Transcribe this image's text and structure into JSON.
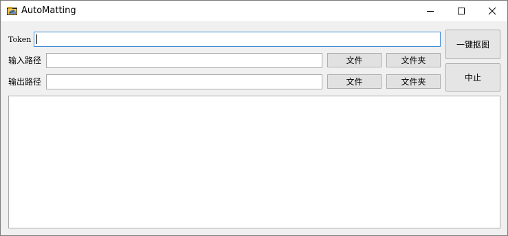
{
  "window": {
    "title": "AutoMatting",
    "icon": "folder-app-icon",
    "controls": {
      "minimize_icon": "minimize-icon",
      "maximize_icon": "maximize-icon",
      "close_icon": "close-icon"
    }
  },
  "form": {
    "token": {
      "label": "Token",
      "value": "",
      "placeholder": ""
    },
    "input_path": {
      "label": "输入路径",
      "value": "",
      "file_button": "文件",
      "folder_button": "文件夹"
    },
    "output_path": {
      "label": "输出路径",
      "value": "",
      "file_button": "文件",
      "folder_button": "文件夹"
    }
  },
  "actions": {
    "one_click_matting": "一键抠图",
    "stop": "中止"
  },
  "log": {
    "text": ""
  },
  "colors": {
    "window_bg": "#f0f0f0",
    "focus_border": "#3d8ad6",
    "button_bg": "#e1e1e1"
  }
}
